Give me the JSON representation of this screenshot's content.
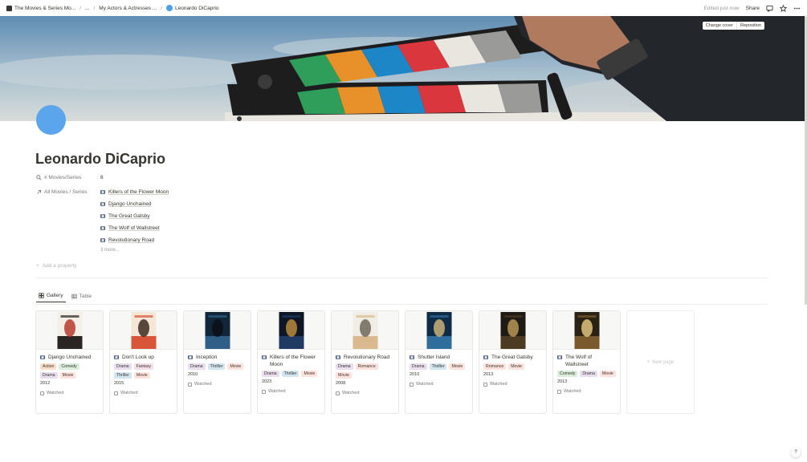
{
  "breadcrumb": {
    "items": [
      {
        "label": "The Movies & Series Mo..."
      },
      {
        "label": "..."
      },
      {
        "label": "My Actors & Actresses ..."
      },
      {
        "label": "Leonardo DiCaprio"
      }
    ]
  },
  "topbar": {
    "edited": "Edited just now",
    "share": "Share"
  },
  "cover": {
    "change_label": "Change cover",
    "reposition_label": "Reposition"
  },
  "page": {
    "title": "Leonardo DiCaprio"
  },
  "properties": {
    "count_label": "# Movies/Series",
    "count_value": "8",
    "relation_label": "All Movies / Series",
    "relations": [
      "Killers of the Flower Moon",
      "Django Unchained",
      "The Great Gatsby",
      "The Wolf of Wallstreet",
      "Revolutionary Road"
    ],
    "more": "3 more...",
    "add_property": "Add a property"
  },
  "views": {
    "gallery": "Gallery",
    "table": "Table"
  },
  "gallery": {
    "cards": [
      {
        "title": "Django Unchained",
        "tags": [
          {
            "t": "Action",
            "c": "#fadec9"
          },
          {
            "t": "Comedy",
            "c": "#dbeddb"
          },
          {
            "t": "Drama",
            "c": "#e8deee"
          },
          {
            "t": "Movie",
            "c": "#ffe2dd"
          }
        ],
        "year": "2012",
        "watched": "Watched"
      },
      {
        "title": "Don't Look up",
        "tags": [
          {
            "t": "Drama",
            "c": "#e8deee"
          },
          {
            "t": "Fantasy",
            "c": "#f5e0e9"
          },
          {
            "t": "Thriller",
            "c": "#d3e5ef"
          },
          {
            "t": "Movie",
            "c": "#ffe2dd"
          }
        ],
        "year": "2015",
        "watched": "Watched"
      },
      {
        "title": "Inception",
        "tags": [
          {
            "t": "Drama",
            "c": "#e8deee"
          },
          {
            "t": "Thriller",
            "c": "#d3e5ef"
          },
          {
            "t": "Movie",
            "c": "#ffe2dd"
          }
        ],
        "year": "2010",
        "watched": "Watched"
      },
      {
        "title": "Killers of the Flower Moon",
        "tags": [
          {
            "t": "Drama",
            "c": "#e8deee"
          },
          {
            "t": "Thriller",
            "c": "#d3e5ef"
          },
          {
            "t": "Movie",
            "c": "#ffe2dd"
          }
        ],
        "year": "2023",
        "watched": "Watched"
      },
      {
        "title": "Revolutionary Road",
        "tags": [
          {
            "t": "Drama",
            "c": "#e8deee"
          },
          {
            "t": "Romance",
            "c": "#ffe2dd"
          },
          {
            "t": "Movie",
            "c": "#ffe2dd"
          }
        ],
        "year": "2008",
        "watched": "Watched"
      },
      {
        "title": "Shutter Island",
        "tags": [
          {
            "t": "Drama",
            "c": "#e8deee"
          },
          {
            "t": "Thriller",
            "c": "#d3e5ef"
          },
          {
            "t": "Movie",
            "c": "#ffe2dd"
          }
        ],
        "year": "2010",
        "watched": "Watched"
      },
      {
        "title": "The Great Gatsby",
        "tags": [
          {
            "t": "Romance",
            "c": "#ffe2dd"
          },
          {
            "t": "Movie",
            "c": "#ffe2dd"
          }
        ],
        "year": "2013",
        "watched": "Watched"
      },
      {
        "title": "The Wolf of Wallstreet",
        "tags": [
          {
            "t": "Comedy",
            "c": "#dbeddb"
          },
          {
            "t": "Drama",
            "c": "#e8deee"
          },
          {
            "t": "Movie",
            "c": "#ffe2dd"
          }
        ],
        "year": "2013",
        "watched": "Watched"
      }
    ],
    "new_page": "New page"
  },
  "colors": {
    "accent": "#5aa5ec",
    "text": "#37352f",
    "muted": "#787774"
  }
}
